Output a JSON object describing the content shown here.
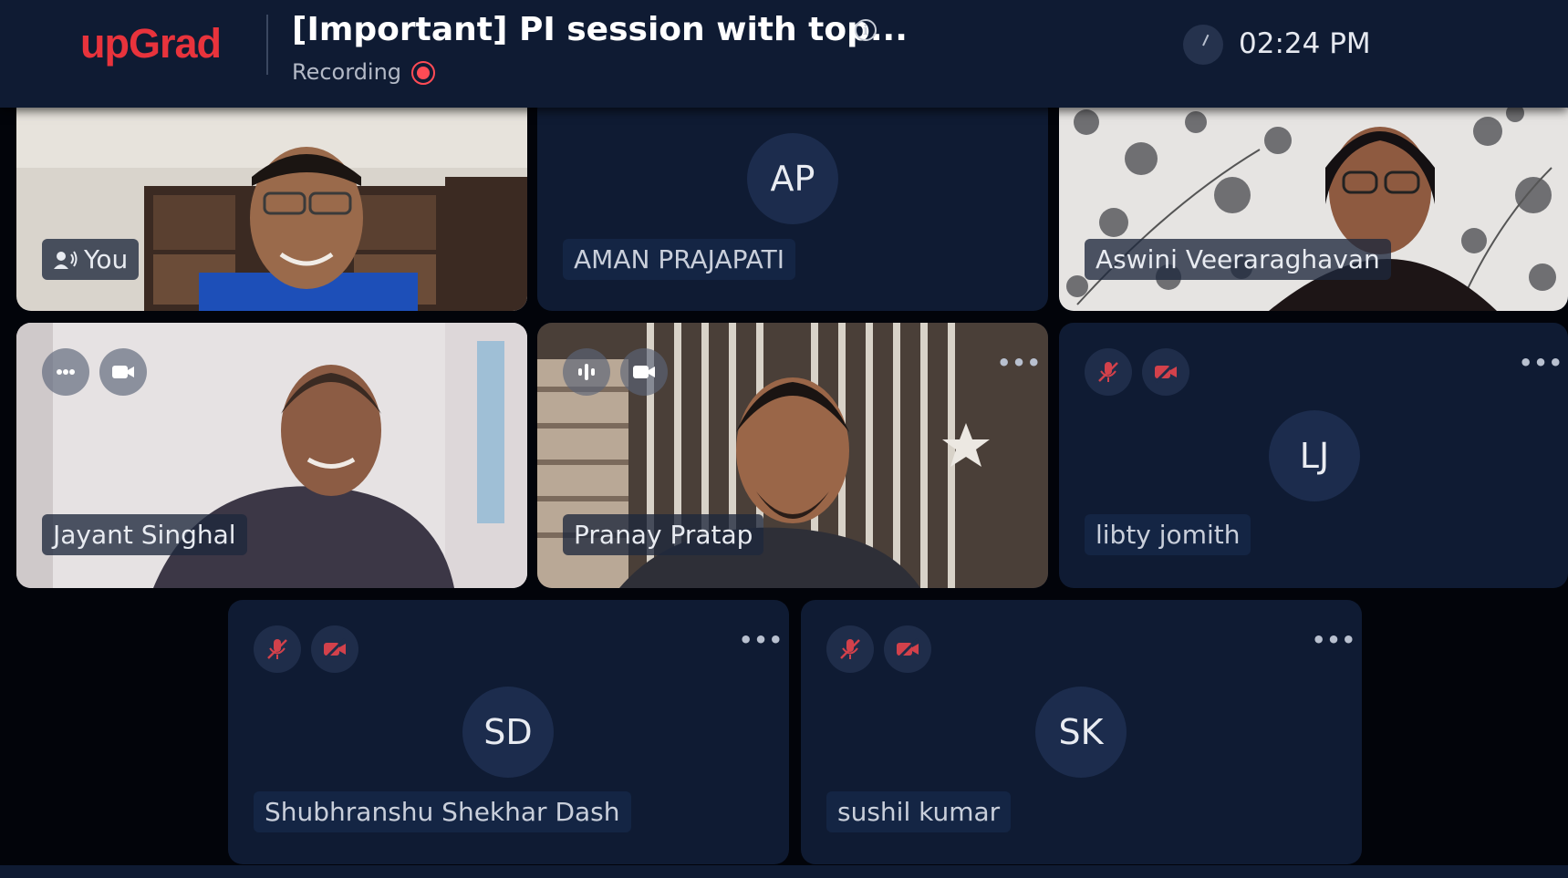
{
  "header": {
    "logo": "upGrad",
    "title": "[Important] PI session with top...",
    "recording_label": "Recording",
    "time": "02:24 PM",
    "info_icon": "info-icon",
    "clock_icon": "clock-icon"
  },
  "participants": [
    {
      "name": "You",
      "type": "video",
      "speaking": true
    },
    {
      "name": "AMAN PRAJAPATI",
      "initials": "AP",
      "type": "avatar"
    },
    {
      "name": "Aswini Veeraraghavan",
      "type": "video"
    },
    {
      "name": "Jayant Singhal",
      "type": "video"
    },
    {
      "name": "Pranay Pratap",
      "type": "video"
    },
    {
      "name": "libty jomith",
      "initials": "LJ",
      "type": "avatar",
      "mic": "muted",
      "camera": "off"
    },
    {
      "name": "Shubhranshu Shekhar Dash",
      "initials": "SD",
      "type": "avatar",
      "mic": "muted",
      "camera": "off"
    },
    {
      "name": "sushil kumar",
      "initials": "SK",
      "type": "avatar",
      "mic": "muted",
      "camera": "off"
    }
  ],
  "colors": {
    "brand": "#e8333c",
    "header_bg": "#0f1b33",
    "page_bg": "#02040a",
    "tile_bg": "#0f1b33",
    "muted_icon": "#d2414b",
    "recording": "#ff4b55"
  },
  "more_options_glyph": "•••"
}
